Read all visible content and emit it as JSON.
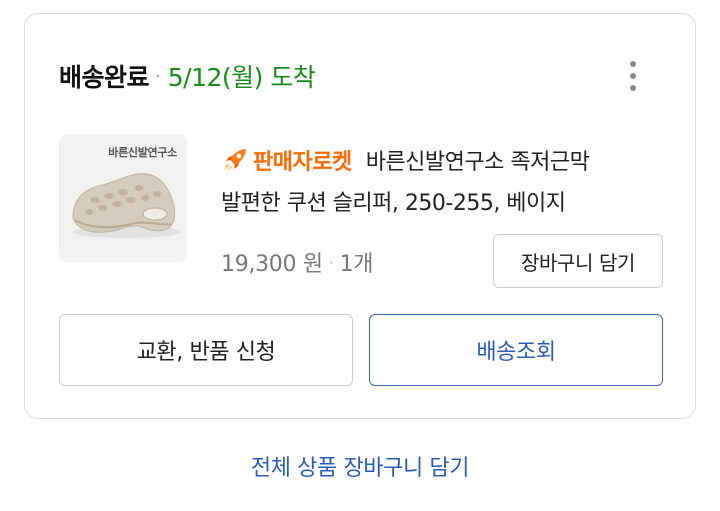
{
  "order": {
    "status": "배송완료",
    "separator": "·",
    "arrival": "5/12(월) 도착",
    "more_icon": "more-vertical-icon"
  },
  "product": {
    "thumbnail_brand": "바른신발연구소",
    "seller_badge": "판매자로켓",
    "badge_icon": "rocket-icon",
    "name_line1": "바른신발연구소 족저근막",
    "name_line2": "발편한 쿠션 슬리퍼, 250-255, 베이지",
    "price": "19,300 원",
    "price_separator": "·",
    "quantity": "1개",
    "add_to_cart_label": "장바구니 담기"
  },
  "actions": {
    "exchange_return_label": "교환, 반품 신청",
    "tracking_label": "배송조회"
  },
  "footer": {
    "add_all_to_cart_label": "전체 상품 장바구니 담기"
  },
  "colors": {
    "arrival_green": "#198c19",
    "badge_orange": "#ff6a00",
    "primary_blue": "#2d5cb8"
  }
}
